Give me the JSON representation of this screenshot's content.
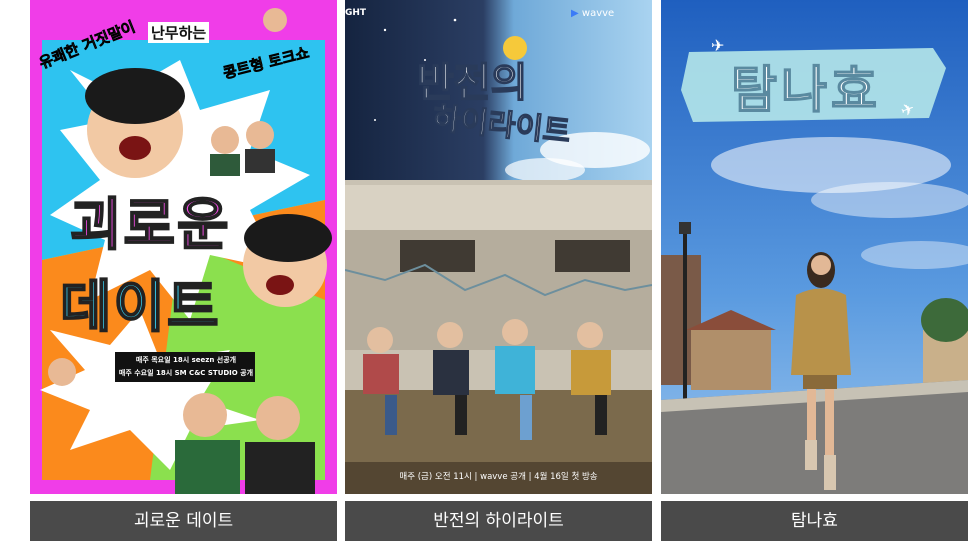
{
  "cards": [
    {
      "caption": "괴로운 데이트",
      "poster": {
        "tagline_left": "유쾌한 거짓말이",
        "tagline_mid": "난무하는",
        "tagline_right": "콩트형 토크쇼",
        "title_line1": "괴로운",
        "title_line2": "데이트",
        "schedule_line1": "매주 목요일 18시 seezn 선공개",
        "schedule_line2": "매주 수요일 18시 SM C&C STUDIO 공개"
      }
    },
    {
      "caption": "반전의 하이라이트",
      "poster": {
        "brand": "wavve",
        "corner_text": "GHT",
        "title_line1": "반전의",
        "title_line2": "하이라이트",
        "bottom_line": "매주 (금) 오전 11시 | wavve 공개 | 4월 16일 첫 방송"
      }
    },
    {
      "caption": "탐나효",
      "poster": {
        "title": "탐나효"
      }
    }
  ],
  "colors": {
    "caption_bg": "#4a4a4a",
    "caption_text": "#ffffff"
  }
}
